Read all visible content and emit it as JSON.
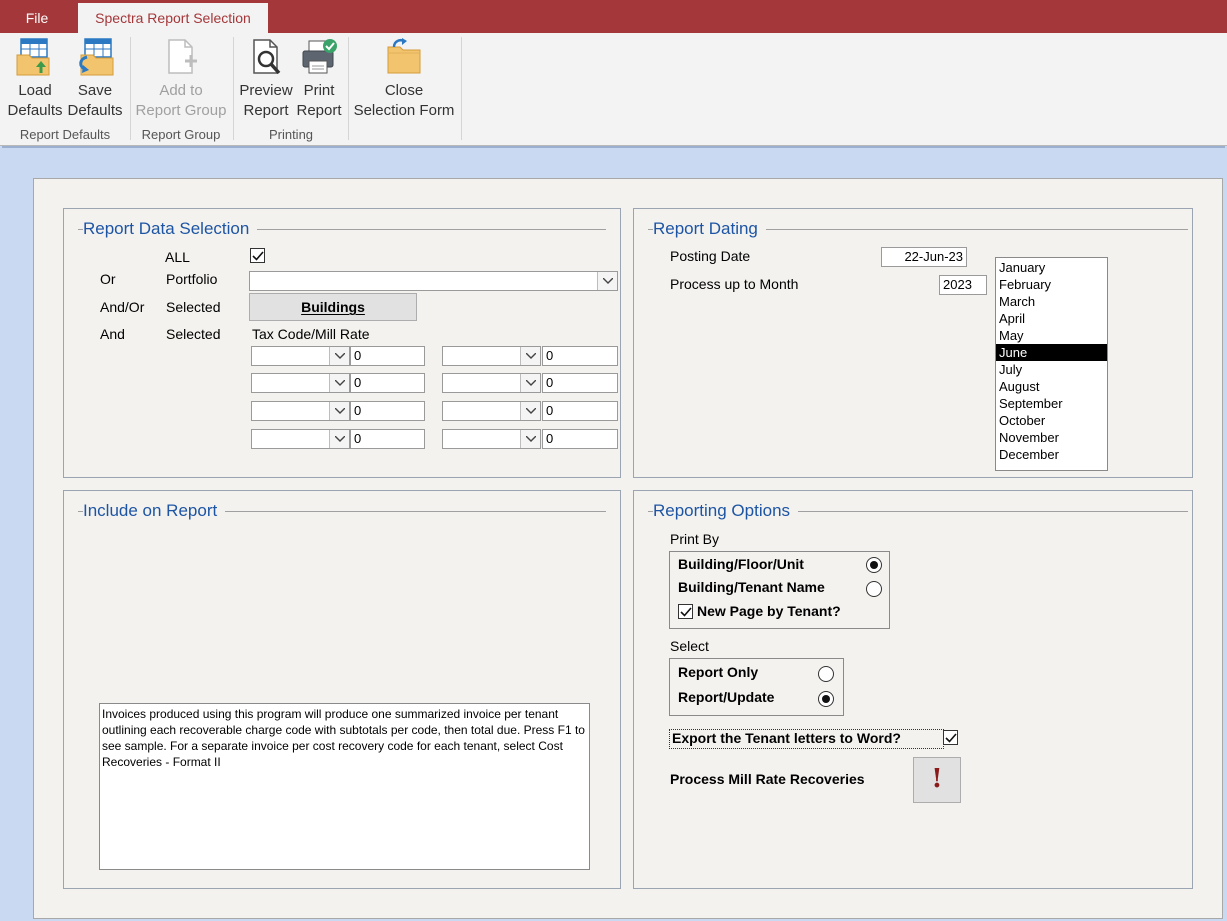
{
  "tabs": {
    "file": "File",
    "active": "Spectra Report Selection"
  },
  "ribbon": {
    "load_defaults": [
      "Load",
      "Defaults"
    ],
    "save_defaults": [
      "Save",
      "Defaults"
    ],
    "group_report_defaults": "Report Defaults",
    "add_to_group": [
      "Add to",
      "Report Group"
    ],
    "group_report_group": "Report Group",
    "preview_report": [
      "Preview",
      "Report"
    ],
    "print_report": [
      "Print",
      "Report"
    ],
    "group_printing": "Printing",
    "close_selection": [
      "Close",
      "Selection Form"
    ]
  },
  "data_selection": {
    "title": "Report Data Selection",
    "all_label": "ALL",
    "all_checked": true,
    "or_label": "Or",
    "portfolio_label": "Portfolio",
    "portfolio_value": "",
    "andor_label": "And/Or",
    "selected_label": "Selected",
    "buildings_button": "Buildings",
    "and_label": "And",
    "selected_label2": "Selected",
    "taxcode_header": "Tax Code/Mill Rate",
    "tax_rows": [
      {
        "left_combo": "",
        "left_value": "0",
        "right_combo": "",
        "right_value": "0"
      },
      {
        "left_combo": "",
        "left_value": "0",
        "right_combo": "",
        "right_value": "0"
      },
      {
        "left_combo": "",
        "left_value": "0",
        "right_combo": "",
        "right_value": "0"
      },
      {
        "left_combo": "",
        "left_value": "0",
        "right_combo": "",
        "right_value": "0"
      }
    ]
  },
  "report_dating": {
    "title": "Report Dating",
    "posting_date_label": "Posting Date",
    "posting_date_value": "22-Jun-23",
    "process_month_label": "Process up to Month",
    "process_year_value": "2023",
    "months": [
      "January",
      "February",
      "March",
      "April",
      "May",
      "June",
      "July",
      "August",
      "September",
      "October",
      "November",
      "December"
    ],
    "selected_month": "June"
  },
  "include_on_report": {
    "title": "Include on Report",
    "description": "Invoices produced using this program will produce one summarized invoice per tenant outlining each recoverable charge code with subtotals per code, then total due. Press F1 to see sample. For a separate invoice per cost recovery code for each tenant, select Cost Recoveries - Format II"
  },
  "reporting_options": {
    "title": "Reporting Options",
    "print_by_label": "Print By",
    "opt_building_floor_unit": "Building/Floor/Unit",
    "opt_building_floor_unit_selected": true,
    "opt_building_tenant_name": "Building/Tenant Name",
    "opt_building_tenant_name_selected": false,
    "new_page_label": "New Page by Tenant?",
    "new_page_checked": true,
    "select_label": "Select",
    "opt_report_only": "Report Only",
    "opt_report_only_selected": false,
    "opt_report_update": "Report/Update",
    "opt_report_update_selected": true,
    "export_label": "Export the Tenant letters to Word?",
    "export_checked": true,
    "process_mill_label": "Process Mill Rate Recoveries",
    "process_button_glyph": "!"
  }
}
